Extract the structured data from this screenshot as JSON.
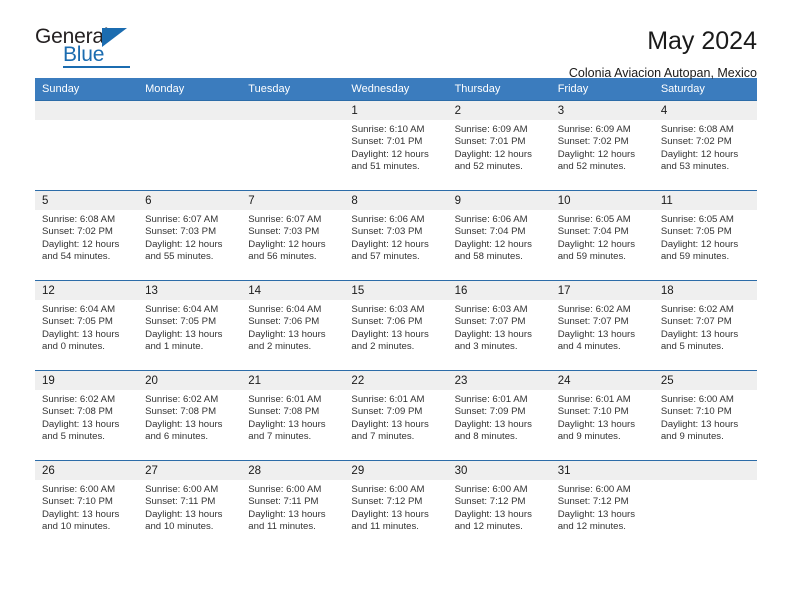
{
  "brand": {
    "name_top": "General",
    "name_bottom": "Blue",
    "triangle_icon": "blue-triangle-icon",
    "accent_color": "#1b6cb0"
  },
  "header": {
    "title": "May 2024",
    "subtitle": "Colonia Aviacion Autopan, Mexico"
  },
  "theme": {
    "header_bg": "#3b7cbe",
    "cell_top_border": "#2c6ca8",
    "daynum_band_bg": "#efefef"
  },
  "weekdays": [
    "Sunday",
    "Monday",
    "Tuesday",
    "Wednesday",
    "Thursday",
    "Friday",
    "Saturday"
  ],
  "weeks": [
    [
      {
        "day": "",
        "sunrise": "",
        "sunset": "",
        "daylight_line1": "",
        "daylight_line2": "",
        "empty": true
      },
      {
        "day": "",
        "sunrise": "",
        "sunset": "",
        "daylight_line1": "",
        "daylight_line2": "",
        "empty": true
      },
      {
        "day": "",
        "sunrise": "",
        "sunset": "",
        "daylight_line1": "",
        "daylight_line2": "",
        "empty": true
      },
      {
        "day": "1",
        "sunrise": "Sunrise: 6:10 AM",
        "sunset": "Sunset: 7:01 PM",
        "daylight_line1": "Daylight: 12 hours",
        "daylight_line2": "and 51 minutes."
      },
      {
        "day": "2",
        "sunrise": "Sunrise: 6:09 AM",
        "sunset": "Sunset: 7:01 PM",
        "daylight_line1": "Daylight: 12 hours",
        "daylight_line2": "and 52 minutes."
      },
      {
        "day": "3",
        "sunrise": "Sunrise: 6:09 AM",
        "sunset": "Sunset: 7:02 PM",
        "daylight_line1": "Daylight: 12 hours",
        "daylight_line2": "and 52 minutes."
      },
      {
        "day": "4",
        "sunrise": "Sunrise: 6:08 AM",
        "sunset": "Sunset: 7:02 PM",
        "daylight_line1": "Daylight: 12 hours",
        "daylight_line2": "and 53 minutes."
      }
    ],
    [
      {
        "day": "5",
        "sunrise": "Sunrise: 6:08 AM",
        "sunset": "Sunset: 7:02 PM",
        "daylight_line1": "Daylight: 12 hours",
        "daylight_line2": "and 54 minutes."
      },
      {
        "day": "6",
        "sunrise": "Sunrise: 6:07 AM",
        "sunset": "Sunset: 7:03 PM",
        "daylight_line1": "Daylight: 12 hours",
        "daylight_line2": "and 55 minutes."
      },
      {
        "day": "7",
        "sunrise": "Sunrise: 6:07 AM",
        "sunset": "Sunset: 7:03 PM",
        "daylight_line1": "Daylight: 12 hours",
        "daylight_line2": "and 56 minutes."
      },
      {
        "day": "8",
        "sunrise": "Sunrise: 6:06 AM",
        "sunset": "Sunset: 7:03 PM",
        "daylight_line1": "Daylight: 12 hours",
        "daylight_line2": "and 57 minutes."
      },
      {
        "day": "9",
        "sunrise": "Sunrise: 6:06 AM",
        "sunset": "Sunset: 7:04 PM",
        "daylight_line1": "Daylight: 12 hours",
        "daylight_line2": "and 58 minutes."
      },
      {
        "day": "10",
        "sunrise": "Sunrise: 6:05 AM",
        "sunset": "Sunset: 7:04 PM",
        "daylight_line1": "Daylight: 12 hours",
        "daylight_line2": "and 59 minutes."
      },
      {
        "day": "11",
        "sunrise": "Sunrise: 6:05 AM",
        "sunset": "Sunset: 7:05 PM",
        "daylight_line1": "Daylight: 12 hours",
        "daylight_line2": "and 59 minutes."
      }
    ],
    [
      {
        "day": "12",
        "sunrise": "Sunrise: 6:04 AM",
        "sunset": "Sunset: 7:05 PM",
        "daylight_line1": "Daylight: 13 hours",
        "daylight_line2": "and 0 minutes."
      },
      {
        "day": "13",
        "sunrise": "Sunrise: 6:04 AM",
        "sunset": "Sunset: 7:05 PM",
        "daylight_line1": "Daylight: 13 hours",
        "daylight_line2": "and 1 minute."
      },
      {
        "day": "14",
        "sunrise": "Sunrise: 6:04 AM",
        "sunset": "Sunset: 7:06 PM",
        "daylight_line1": "Daylight: 13 hours",
        "daylight_line2": "and 2 minutes."
      },
      {
        "day": "15",
        "sunrise": "Sunrise: 6:03 AM",
        "sunset": "Sunset: 7:06 PM",
        "daylight_line1": "Daylight: 13 hours",
        "daylight_line2": "and 2 minutes."
      },
      {
        "day": "16",
        "sunrise": "Sunrise: 6:03 AM",
        "sunset": "Sunset: 7:07 PM",
        "daylight_line1": "Daylight: 13 hours",
        "daylight_line2": "and 3 minutes."
      },
      {
        "day": "17",
        "sunrise": "Sunrise: 6:02 AM",
        "sunset": "Sunset: 7:07 PM",
        "daylight_line1": "Daylight: 13 hours",
        "daylight_line2": "and 4 minutes."
      },
      {
        "day": "18",
        "sunrise": "Sunrise: 6:02 AM",
        "sunset": "Sunset: 7:07 PM",
        "daylight_line1": "Daylight: 13 hours",
        "daylight_line2": "and 5 minutes."
      }
    ],
    [
      {
        "day": "19",
        "sunrise": "Sunrise: 6:02 AM",
        "sunset": "Sunset: 7:08 PM",
        "daylight_line1": "Daylight: 13 hours",
        "daylight_line2": "and 5 minutes."
      },
      {
        "day": "20",
        "sunrise": "Sunrise: 6:02 AM",
        "sunset": "Sunset: 7:08 PM",
        "daylight_line1": "Daylight: 13 hours",
        "daylight_line2": "and 6 minutes."
      },
      {
        "day": "21",
        "sunrise": "Sunrise: 6:01 AM",
        "sunset": "Sunset: 7:08 PM",
        "daylight_line1": "Daylight: 13 hours",
        "daylight_line2": "and 7 minutes."
      },
      {
        "day": "22",
        "sunrise": "Sunrise: 6:01 AM",
        "sunset": "Sunset: 7:09 PM",
        "daylight_line1": "Daylight: 13 hours",
        "daylight_line2": "and 7 minutes."
      },
      {
        "day": "23",
        "sunrise": "Sunrise: 6:01 AM",
        "sunset": "Sunset: 7:09 PM",
        "daylight_line1": "Daylight: 13 hours",
        "daylight_line2": "and 8 minutes."
      },
      {
        "day": "24",
        "sunrise": "Sunrise: 6:01 AM",
        "sunset": "Sunset: 7:10 PM",
        "daylight_line1": "Daylight: 13 hours",
        "daylight_line2": "and 9 minutes."
      },
      {
        "day": "25",
        "sunrise": "Sunrise: 6:00 AM",
        "sunset": "Sunset: 7:10 PM",
        "daylight_line1": "Daylight: 13 hours",
        "daylight_line2": "and 9 minutes."
      }
    ],
    [
      {
        "day": "26",
        "sunrise": "Sunrise: 6:00 AM",
        "sunset": "Sunset: 7:10 PM",
        "daylight_line1": "Daylight: 13 hours",
        "daylight_line2": "and 10 minutes."
      },
      {
        "day": "27",
        "sunrise": "Sunrise: 6:00 AM",
        "sunset": "Sunset: 7:11 PM",
        "daylight_line1": "Daylight: 13 hours",
        "daylight_line2": "and 10 minutes."
      },
      {
        "day": "28",
        "sunrise": "Sunrise: 6:00 AM",
        "sunset": "Sunset: 7:11 PM",
        "daylight_line1": "Daylight: 13 hours",
        "daylight_line2": "and 11 minutes."
      },
      {
        "day": "29",
        "sunrise": "Sunrise: 6:00 AM",
        "sunset": "Sunset: 7:12 PM",
        "daylight_line1": "Daylight: 13 hours",
        "daylight_line2": "and 11 minutes."
      },
      {
        "day": "30",
        "sunrise": "Sunrise: 6:00 AM",
        "sunset": "Sunset: 7:12 PM",
        "daylight_line1": "Daylight: 13 hours",
        "daylight_line2": "and 12 minutes."
      },
      {
        "day": "31",
        "sunrise": "Sunrise: 6:00 AM",
        "sunset": "Sunset: 7:12 PM",
        "daylight_line1": "Daylight: 13 hours",
        "daylight_line2": "and 12 minutes."
      },
      {
        "day": "",
        "sunrise": "",
        "sunset": "",
        "daylight_line1": "",
        "daylight_line2": "",
        "empty": true
      }
    ]
  ]
}
